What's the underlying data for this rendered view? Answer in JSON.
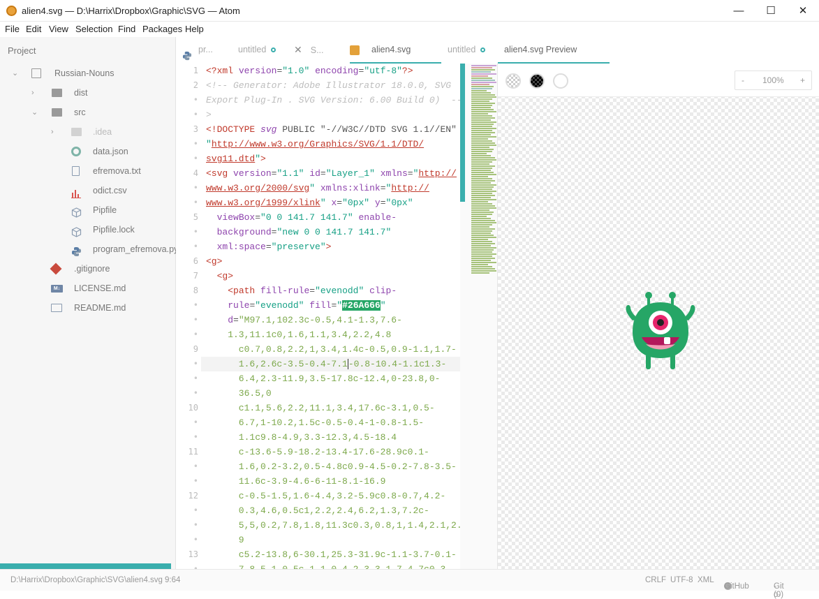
{
  "window": {
    "title": "alien4.svg — D:\\Harrix\\Dropbox\\Graphic\\SVG — Atom",
    "minimize": "—",
    "maximize": "☐",
    "close": "✕"
  },
  "menu": [
    "File",
    "Edit",
    "View",
    "Selection",
    "Find",
    "Packages",
    "Help"
  ],
  "sidebar": {
    "header": "Project",
    "root": "Russian-Nouns",
    "items": [
      {
        "label": "dist"
      },
      {
        "label": "src"
      },
      {
        "label": ".idea"
      },
      {
        "label": "data.json"
      },
      {
        "label": "efremova.txt"
      },
      {
        "label": "odict.csv"
      },
      {
        "label": "Pipfile"
      },
      {
        "label": "Pipfile.lock"
      },
      {
        "label": "program_efremova.py"
      },
      {
        "label": ".gitignore"
      },
      {
        "label": "LICENSE.md"
      },
      {
        "label": "README.md"
      }
    ]
  },
  "tabs": [
    {
      "label": "pr..."
    },
    {
      "label": "untitled"
    },
    {
      "label": "S..."
    },
    {
      "label": "alien4.svg"
    },
    {
      "label": "untitled"
    },
    {
      "label": "alien4.svg Preview"
    }
  ],
  "gutter": [
    "1",
    "2",
    "•",
    "•",
    "3",
    "•",
    "•",
    "4",
    "•",
    "•",
    "5",
    "•",
    "•",
    "6",
    "7",
    "8",
    "•",
    "•",
    "•",
    "9",
    "•",
    "•",
    "•",
    "10",
    "•",
    "•",
    "11",
    "•",
    "•",
    "12",
    "•",
    "•",
    "•",
    "13",
    "•"
  ],
  "preview": {
    "zoom": "100%",
    "zoom_minus": "-",
    "zoom_plus": "+",
    "accent": "#26A666"
  },
  "status": {
    "path": "D:\\Harrix\\Dropbox\\Graphic\\SVG\\alien4.svg",
    "cursor": "9:64",
    "line_ending": "CRLF",
    "encoding": "UTF-8",
    "grammar": "XML",
    "github": "GitHub",
    "git": "Git (0)"
  }
}
